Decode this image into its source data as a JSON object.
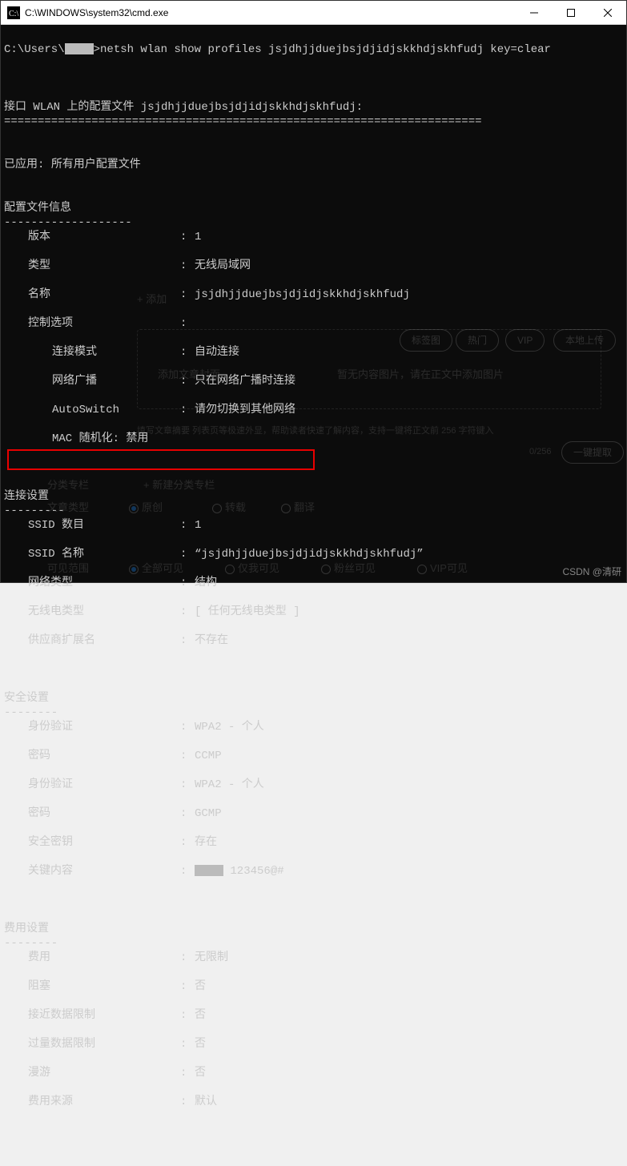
{
  "window": {
    "title": "C:\\WINDOWS\\system32\\cmd.exe"
  },
  "prompt": {
    "path": "C:\\Users\\",
    "command": ">netsh wlan show profiles jsjdhjjduejbsjdjidjskkhdjskhfudj key=clear"
  },
  "header": {
    "line": "接口 WLAN 上的配置文件 jsjdhjjduejbsjdjidjskkhdjskhfudj:",
    "divider": "======================================================================="
  },
  "applied": {
    "label": "已应用",
    "value": "所有用户配置文件"
  },
  "profile": {
    "title": "配置文件信息",
    "dash": "-------------------",
    "rows": [
      {
        "label": "版本",
        "value": "1"
      },
      {
        "label": "类型",
        "value": "无线局域网"
      },
      {
        "label": "名称",
        "value": "jsjdhjjduejbsjdjidjskkhdjskhfudj"
      },
      {
        "label": "控制选项",
        "value": ""
      }
    ],
    "ctrl": [
      {
        "label": "连接模式",
        "value": "自动连接"
      },
      {
        "label": "网络广播",
        "value": "只在网络广播时连接"
      },
      {
        "label": "AutoSwitch",
        "value": "请勿切换到其他网络"
      },
      {
        "label": "MAC 随机化: 禁用",
        "value": ""
      }
    ]
  },
  "conn": {
    "title": "连接设置",
    "dash": "---------",
    "rows": [
      {
        "label": "SSID 数目",
        "value": "1"
      },
      {
        "label": "SSID 名称",
        "value": "“jsjdhjjduejbsjdjidjskkhdjskhfudj”"
      },
      {
        "label": "网络类型",
        "value": "结构"
      },
      {
        "label": "无线电类型",
        "value": "[ 任何无线电类型 ]"
      },
      {
        "label": "供应商扩展名",
        "value": "不存在"
      }
    ]
  },
  "sec": {
    "title": "安全设置",
    "dash": "--------",
    "rows": [
      {
        "label": "身份验证",
        "value": "WPA2 - 个人"
      },
      {
        "label": "密码",
        "value": "CCMP"
      },
      {
        "label": "身份验证",
        "value": "WPA2 - 个人"
      },
      {
        "label": "密码",
        "value": "GCMP"
      },
      {
        "label": "安全密钥",
        "value": "存在"
      },
      {
        "label": "关键内容",
        "value": "123456@#"
      }
    ]
  },
  "cost": {
    "title": "费用设置",
    "dash": "--------",
    "rows": [
      {
        "label": "费用",
        "value": "无限制"
      },
      {
        "label": "阻塞",
        "value": "否"
      },
      {
        "label": "接近数据限制",
        "value": "否"
      },
      {
        "label": "过量数据限制",
        "value": "否"
      },
      {
        "label": "漫游",
        "value": "否"
      },
      {
        "label": "费用来源",
        "value": "默认"
      }
    ]
  },
  "ghost": {
    "addTag": "+ 添加",
    "coverText": "添加文章封面",
    "noContent": "暂无内容图片，请在正文中添加图片",
    "tabs": [
      "标签图",
      "热门",
      "VIP",
      "本地上传"
    ],
    "summaryHint": "填写文章摘要  列表页等极速外显，帮助读者快速了解内容，支持一键将正文前 256 字符键入",
    "counter": "0/256",
    "extractBtn": "一键提取",
    "catSection": "分类专栏",
    "newCat": "+ 新建分类专栏",
    "typeSection": "文章类型",
    "types": [
      "原创",
      "转载",
      "翻译"
    ],
    "visSection": "可见范围",
    "visOptions": [
      "全部可见",
      "仅我可见",
      "粉丝可见",
      "VIP可见"
    ]
  },
  "watermark": "CSDN @清研"
}
